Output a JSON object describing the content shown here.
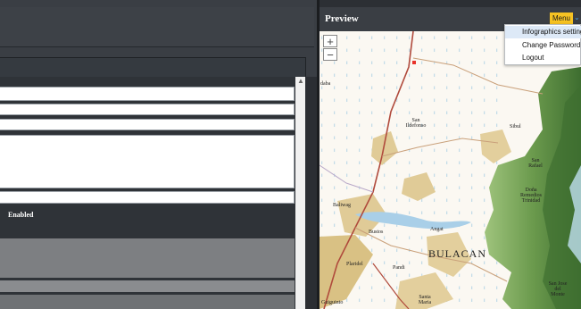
{
  "preview": {
    "title": "Preview",
    "menu_label": "Menu",
    "caret": "⌄"
  },
  "editor": {
    "enabled_label": "Enabled"
  },
  "menu": {
    "items": [
      {
        "label": "Infographics settings"
      },
      {
        "label": "Change Password"
      },
      {
        "label": "Logout"
      }
    ]
  },
  "map": {
    "zoom_in": "+",
    "zoom_out": "−",
    "labels": {
      "bulacan": "BULACAN",
      "san_ildefonso": "San Ildefonso",
      "san_rafael": "San Rafael",
      "dona_remedios": "Doña Remedios Trinidad",
      "bustos": "Bustos",
      "angat": "Angat",
      "baliwag": "Baliwag",
      "pandi": "Pandi",
      "santa_maria": "Santa Maria",
      "san_jose": "San Jose del Monte",
      "plaridel": "Plaridel",
      "sibul": "Sibul",
      "guiguinto": "Guiguinto",
      "daba": "daba"
    },
    "colors": {
      "land": "#fbf8f2",
      "forest_dark": "#4f7f3a",
      "forest_light": "#8ab46a",
      "urban": "#d8c28c",
      "water": "#a9cfe8",
      "road": "#b04a3c"
    }
  }
}
